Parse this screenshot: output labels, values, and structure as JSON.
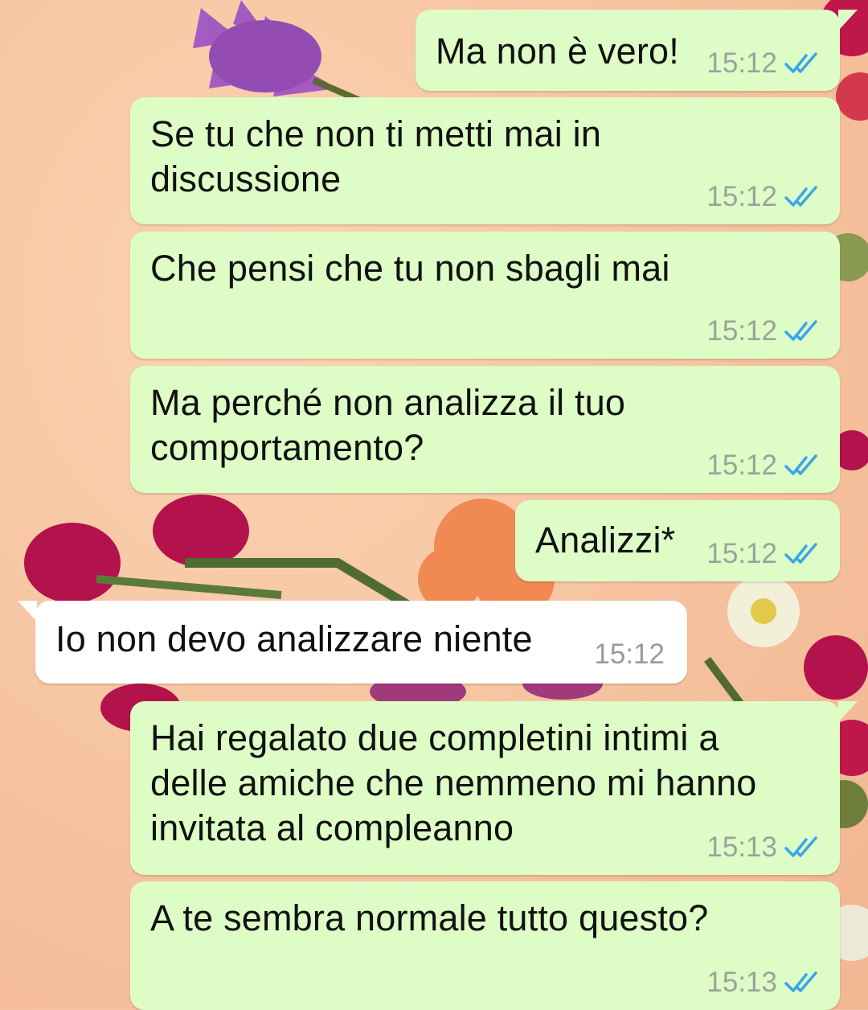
{
  "colors": {
    "outgoing_bubble": "#ddfcc6",
    "incoming_bubble": "#ffffff",
    "read_ticks": "#3aa6e8",
    "wallpaper": "#f6c4a0"
  },
  "wallpaper": {
    "description_icon": "flowers-wallpaper"
  },
  "messages": [
    {
      "direction": "out",
      "text": "Ma non è vero!",
      "time": "15:12",
      "status": "read"
    },
    {
      "direction": "out",
      "text": "Se tu che non ti metti mai in\ndiscussione",
      "time": "15:12",
      "status": "read"
    },
    {
      "direction": "out",
      "text": "Che pensi che tu non sbagli mai",
      "time": "15:12",
      "status": "read"
    },
    {
      "direction": "out",
      "text": "Ma perché non analizza il tuo\ncomportamento?",
      "time": "15:12",
      "status": "read"
    },
    {
      "direction": "out",
      "text": "Analizzi*",
      "time": "15:12",
      "status": "read"
    },
    {
      "direction": "in",
      "text": "Io non devo analizzare niente",
      "time": "15:12"
    },
    {
      "direction": "out",
      "text": "Hai regalato due completini intimi a\ndelle amiche che nemmeno mi hanno\ninvitata al compleanno",
      "time": "15:13",
      "status": "read"
    },
    {
      "direction": "out",
      "text": "A te sembra normale tutto questo?",
      "time": "15:13",
      "status": "read"
    }
  ]
}
